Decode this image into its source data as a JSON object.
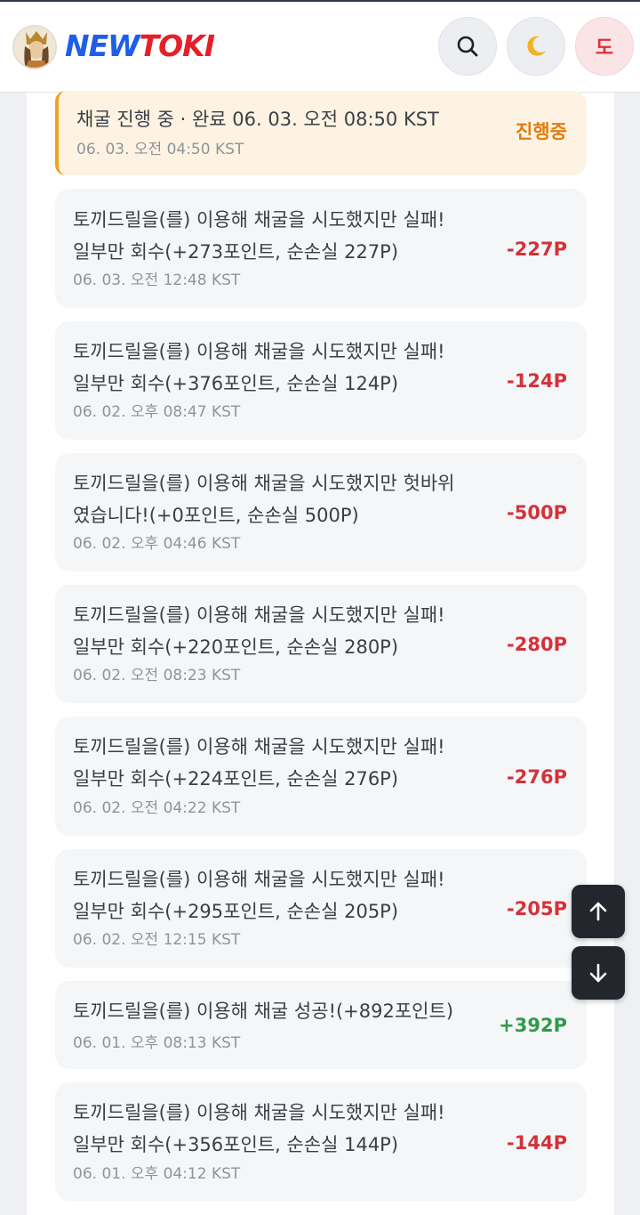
{
  "header": {
    "logo_part1": "NEW",
    "logo_part2": "TOKI",
    "user_initial": "도",
    "icons": [
      "search-icon",
      "moon-icon"
    ]
  },
  "active_mining": {
    "message": "채굴 진행 중 · 완료 06. 03. 오전 08:50 KST",
    "time": "06. 03. 오전 04:50 KST",
    "status": "진행중"
  },
  "history": [
    {
      "line1": "토끼드릴을(를) 이용해 채굴을 시도했지만 실패!",
      "line2": "일부만 회수(+273포인트, 순손실 227P)",
      "time": "06. 03. 오전 12:48 KST",
      "amount": "-227P"
    },
    {
      "line1": "토끼드릴을(를) 이용해 채굴을 시도했지만 실패!",
      "line2": "일부만 회수(+376포인트, 순손실 124P)",
      "time": "06. 02. 오후 08:47 KST",
      "amount": "-124P"
    },
    {
      "line1": "토끼드릴을(를) 이용해 채굴을 시도했지만 헛바위",
      "line2": "였습니다!(+0포인트, 순손실 500P)",
      "time": "06. 02. 오후 04:46 KST",
      "amount": "-500P"
    },
    {
      "line1": "토끼드릴을(를) 이용해 채굴을 시도했지만 실패!",
      "line2": "일부만 회수(+220포인트, 순손실 280P)",
      "time": "06. 02. 오전 08:23 KST",
      "amount": "-280P"
    },
    {
      "line1": "토끼드릴을(를) 이용해 채굴을 시도했지만 실패!",
      "line2": "일부만 회수(+224포인트, 순손실 276P)",
      "time": "06. 02. 오전 04:22 KST",
      "amount": "-276P"
    },
    {
      "line1": "토끼드릴을(를) 이용해 채굴을 시도했지만 실패!",
      "line2": "일부만 회수(+295포인트, 순손실 205P)",
      "time": "06. 02. 오전 12:15 KST",
      "amount": "-205P"
    },
    {
      "line1": "토끼드릴을(를) 이용해 채굴 성공!(+892포인트)",
      "time": "06. 01. 오후 08:13 KST",
      "amount": "+392P"
    },
    {
      "line1": "토끼드릴을(를) 이용해 채굴을 시도했지만 실패!",
      "line2": "일부만 회수(+356포인트, 순손실 144P)",
      "time": "06. 01. 오후 04:12 KST",
      "amount": "-144P"
    }
  ],
  "colors": {
    "negative": "#d3323a",
    "positive": "#2f9b49",
    "in_progress": "#e07d12",
    "logo_blue": "#1f5ee8",
    "logo_red": "#e4202a"
  },
  "floating": [
    "arrow-up-icon",
    "arrow-down-icon"
  ]
}
